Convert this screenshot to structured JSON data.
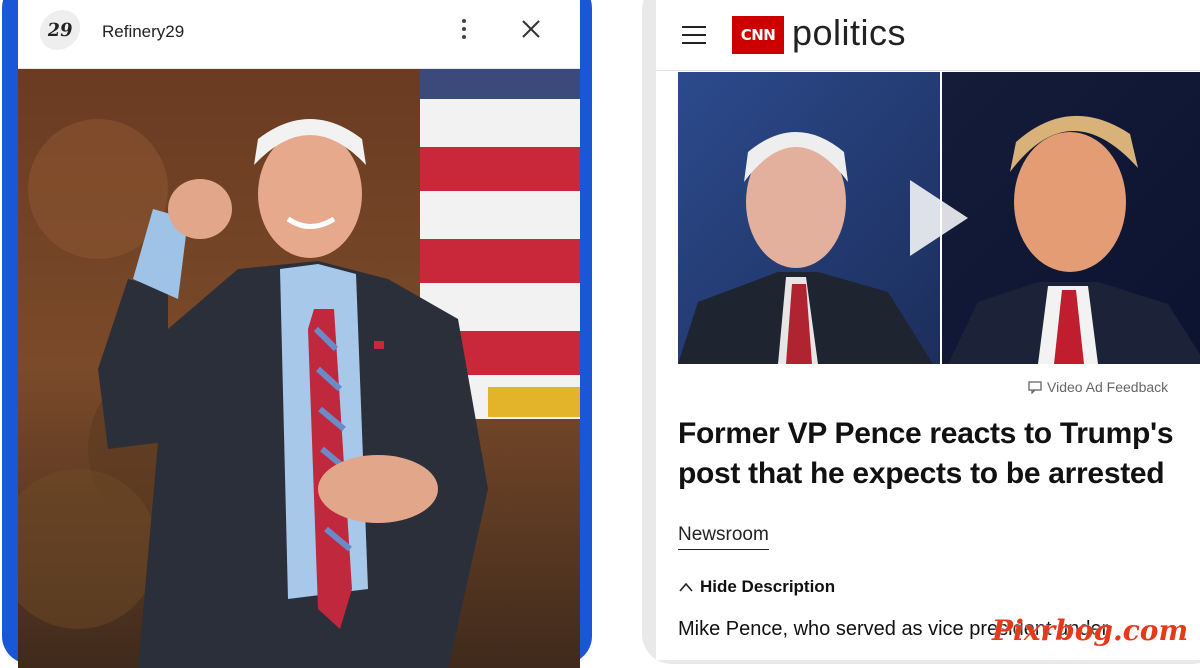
{
  "left_card": {
    "source_logo_text": "29",
    "source_name": "Refinery29",
    "more_icon": "kebab-vertical-icon",
    "close_icon": "close-icon"
  },
  "right_card": {
    "brand_logo": "CNN",
    "section": "politics",
    "ad_feedback": "Video Ad Feedback",
    "headline": "Former VP Pence reacts to Trump's post that he expects to be arrested",
    "channel": "Newsroom",
    "toggle_label": "Hide Description",
    "description": "Mike Pence, who served as vice president under"
  },
  "watermark": "Pixrbog.com",
  "colors": {
    "left_border": "#1a57d6",
    "cnn_red": "#cc0000",
    "watermark": "#e8381a"
  }
}
